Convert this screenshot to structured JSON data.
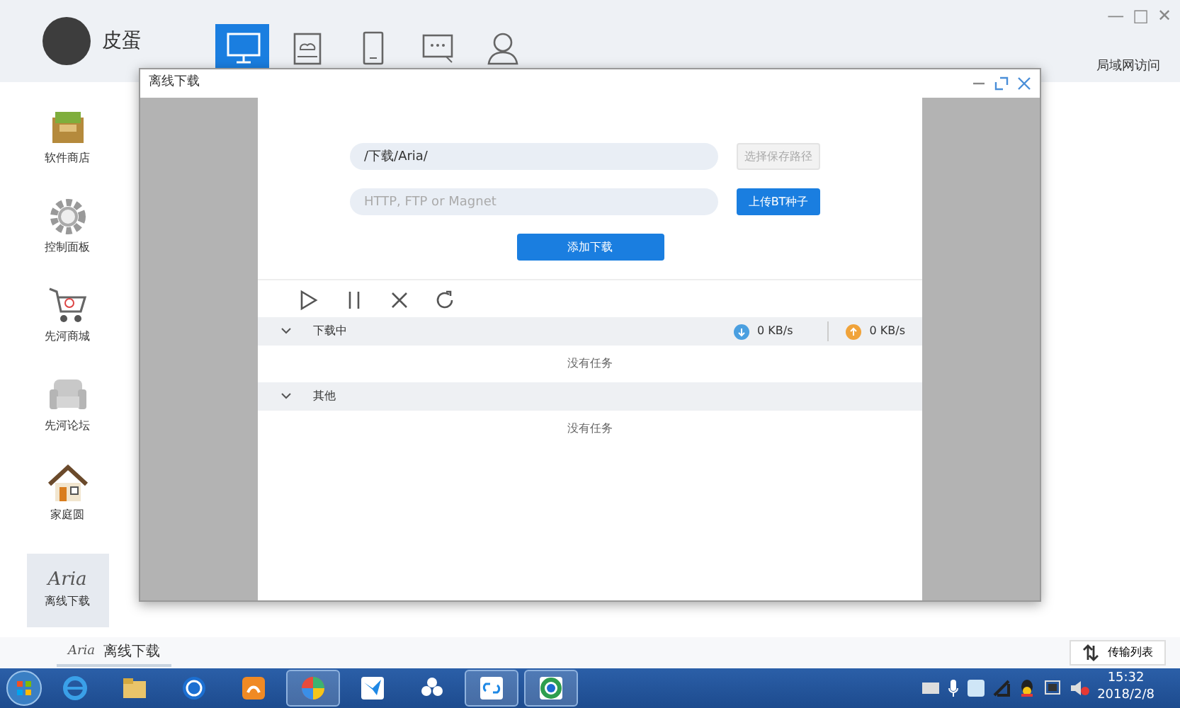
{
  "app": {
    "user_name": "皮蛋",
    "window_controls": [
      "—",
      "□",
      "✕"
    ],
    "lan_access": "局域网访问"
  },
  "top_tabs": [
    {
      "selected": true
    },
    {
      "selected": false
    },
    {
      "selected": false
    },
    {
      "selected": false
    },
    {
      "selected": false
    }
  ],
  "sidebar": {
    "items": [
      {
        "label": "软件商店",
        "selected": false
      },
      {
        "label": "控制面板",
        "selected": false
      },
      {
        "label": "先河商城",
        "selected": false
      },
      {
        "label": "先河论坛",
        "selected": false
      },
      {
        "label": "家庭圆",
        "selected": false
      },
      {
        "logo_text": "Aria",
        "label": "离线下载",
        "selected": true
      }
    ]
  },
  "dialog": {
    "title": "离线下载",
    "path_field": {
      "value": "/下载/Aria/"
    },
    "path_button": {
      "label": "选择保存路径",
      "disabled": true
    },
    "url_field": {
      "placeholder": "HTTP, FTP or Magnet"
    },
    "bt_button": {
      "label": "上传BT种子",
      "disabled": false
    },
    "add_button": {
      "label": "添加下载"
    },
    "groups": [
      {
        "title": "下载中",
        "expanded": true,
        "download_speed": "0 KB/s",
        "upload_speed": "0 KB/s",
        "empty_text": "没有任务"
      },
      {
        "title": "其他",
        "expanded": true,
        "empty_text": "没有任务"
      }
    ]
  },
  "bottom_bar": {
    "task": {
      "logo_text": "Aria",
      "label": "离线下载"
    },
    "transfer_button": "传输列表"
  },
  "taskbar": {
    "apps": [
      {
        "running": false
      },
      {
        "running": false
      },
      {
        "running": false
      },
      {
        "running": false
      },
      {
        "running": true
      },
      {
        "running": false
      },
      {
        "running": false
      },
      {
        "running": true
      },
      {
        "running": true
      }
    ],
    "time": "15:32",
    "date": "2018/2/8"
  }
}
